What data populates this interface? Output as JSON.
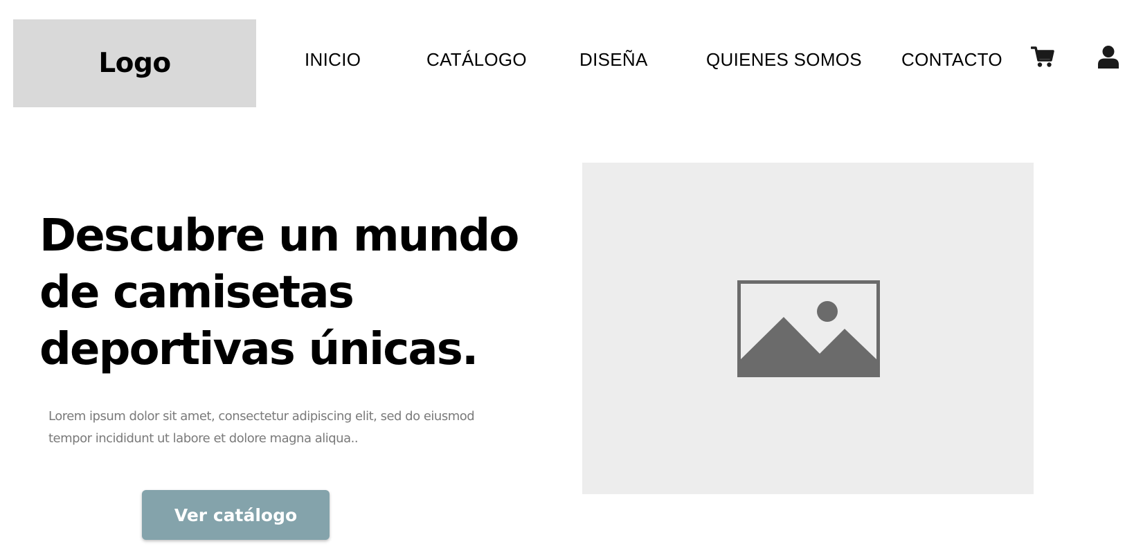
{
  "header": {
    "logo_text": "Logo",
    "nav": [
      {
        "label": "INICIO"
      },
      {
        "label": "CATÁLOGO"
      },
      {
        "label": "DISEÑA"
      },
      {
        "label": "QUIENES SOMOS"
      },
      {
        "label": "CONTACTO"
      }
    ],
    "icons": {
      "cart": "cart-icon",
      "user": "user-icon"
    }
  },
  "hero": {
    "title": "Descubre un mundo de camisetas deportivas únicas.",
    "description": "Lorem ipsum dolor sit amet, consectetur adipiscing elit, sed do eiusmod tempor incididunt ut labore et dolore magna aliqua..",
    "cta_label": "Ver catálogo",
    "image_icon": "image-placeholder-icon"
  },
  "colors": {
    "logo_bg": "#d9d9d9",
    "cta_bg": "#84a3ab",
    "placeholder_bg": "#ededed",
    "placeholder_icon": "#6b6b6b",
    "body_text_muted": "#7a7a7a"
  }
}
